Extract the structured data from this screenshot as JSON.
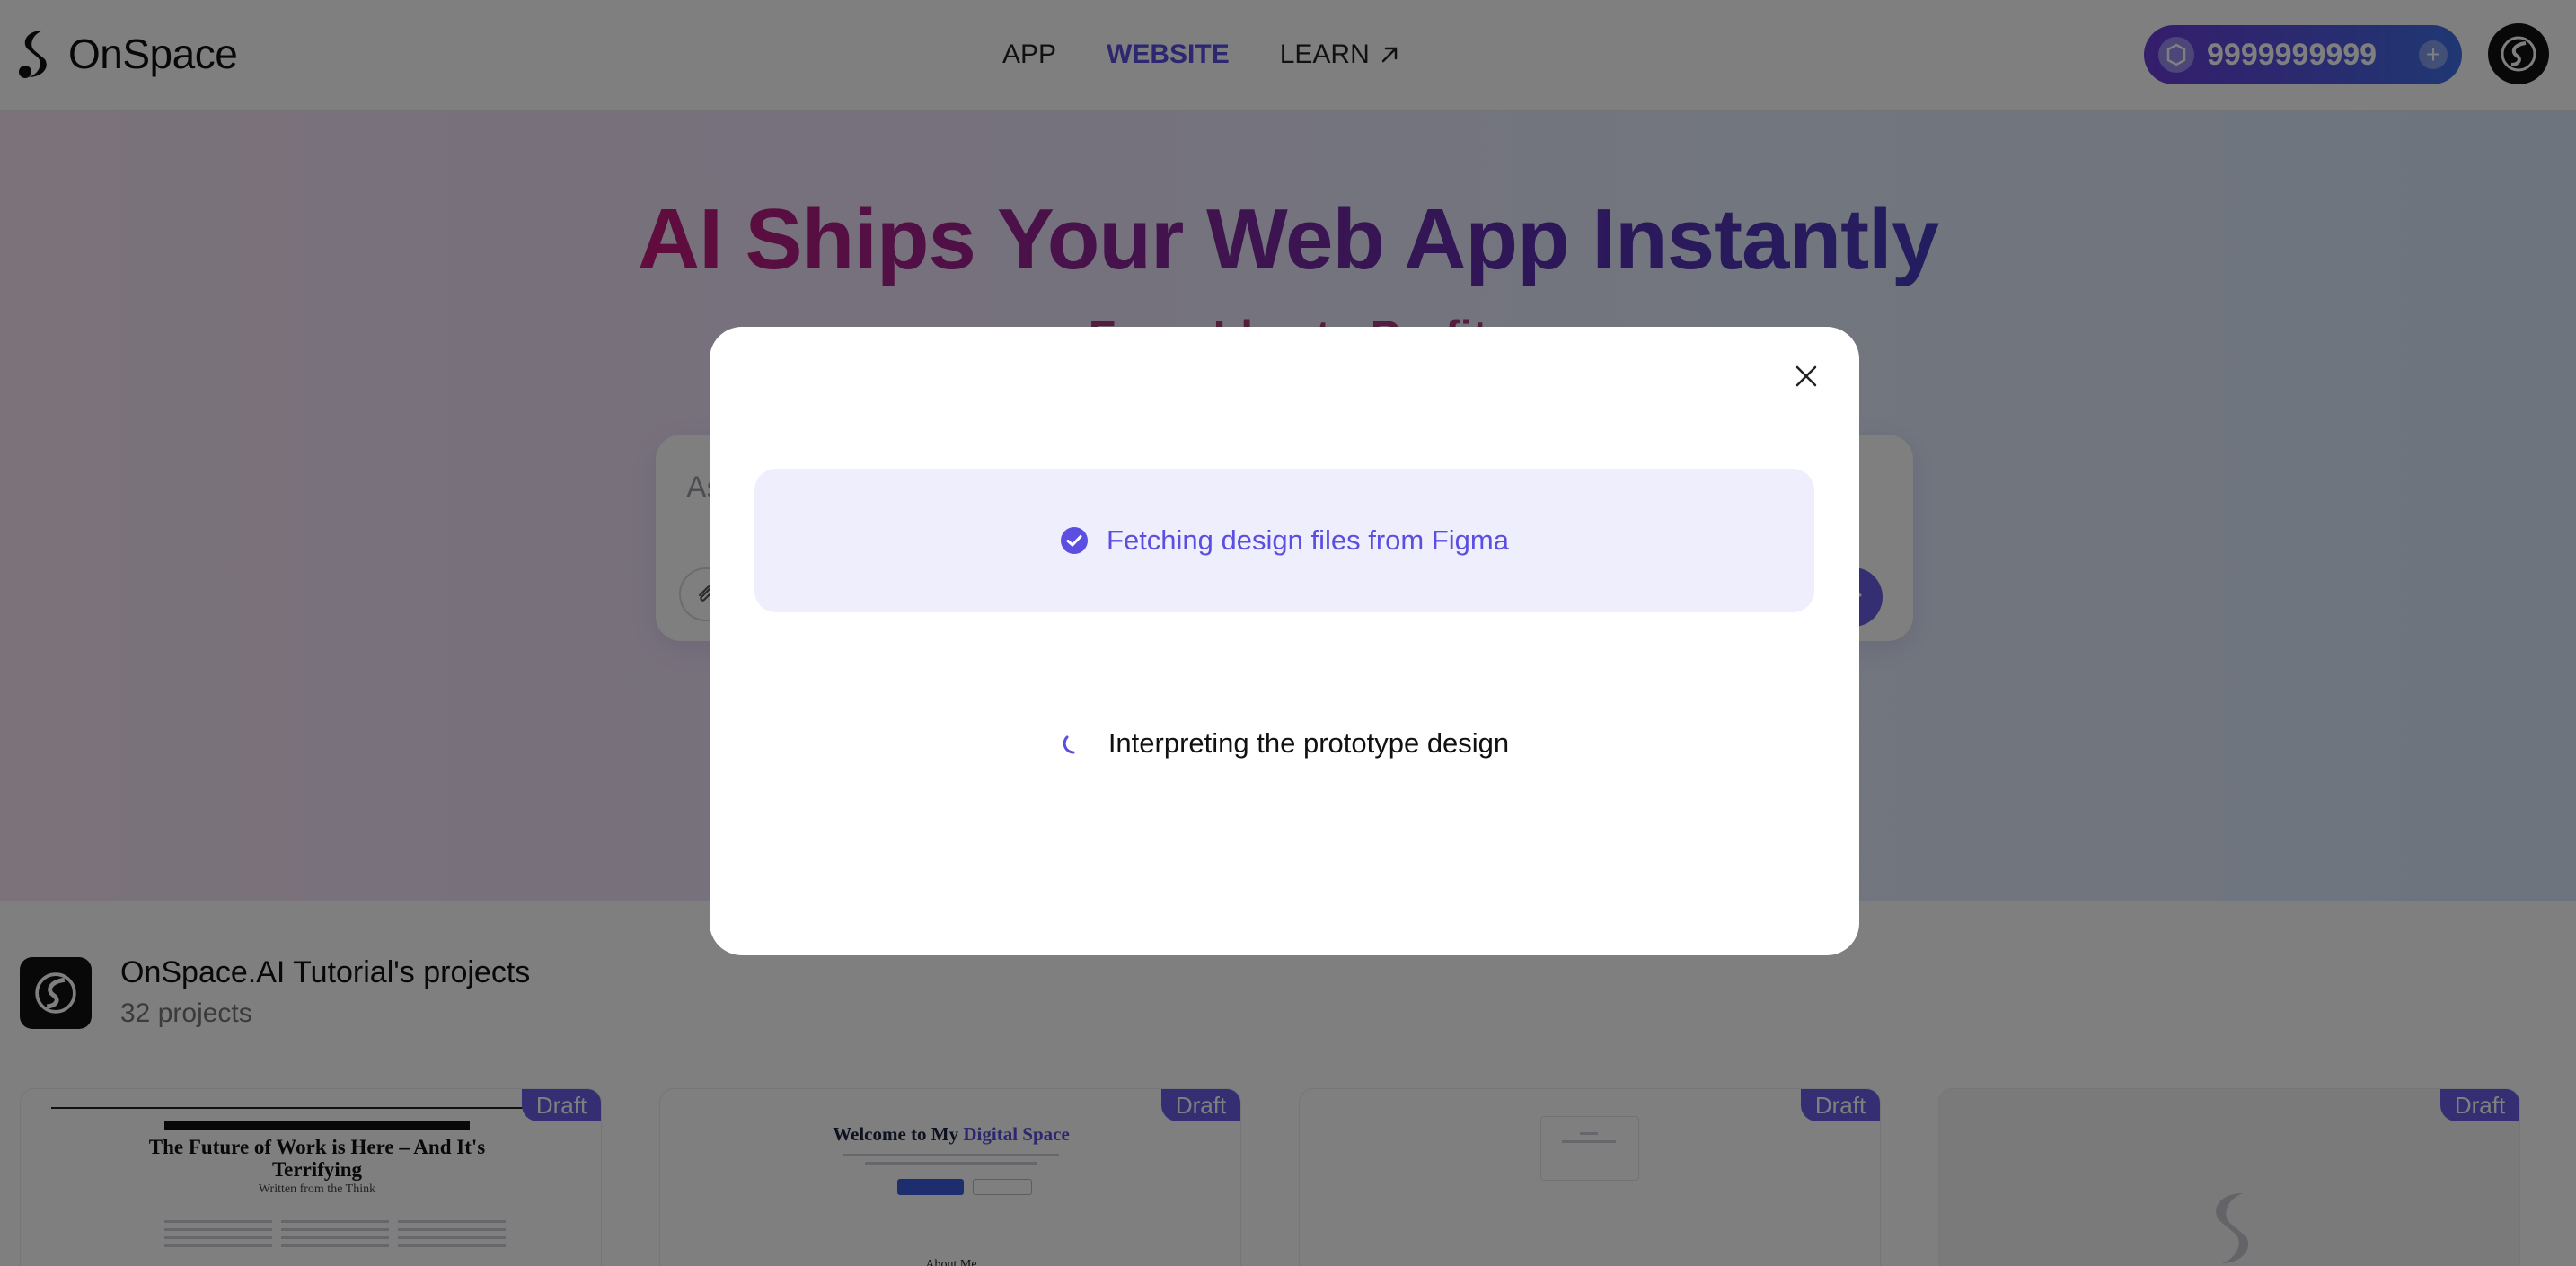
{
  "brand": {
    "name": "OnSpace"
  },
  "nav": {
    "items": [
      {
        "label": "APP"
      },
      {
        "label": "WEBSITE"
      },
      {
        "label": "LEARN"
      }
    ]
  },
  "credits": {
    "value": "9999999999"
  },
  "hero": {
    "title": "AI Ships Your Web App Instantly",
    "subtitle": "From Idea to Profit",
    "prompt_placeholder": "As"
  },
  "projects": {
    "title": "OnSpace.AI Tutorial's projects",
    "count": "32 projects",
    "draft_label": "Draft",
    "cards": [
      {
        "headline": "The Future of Work is Here – And It's Terrifying",
        "byline": "Written from the Think"
      },
      {
        "headline_prefix": "Welcome to My ",
        "headline_accent": "Digital Space",
        "section": "About Me"
      }
    ]
  },
  "modal": {
    "steps": [
      {
        "label": "Fetching design files from Figma",
        "status": "done"
      },
      {
        "label": "Interpreting the prototype design",
        "status": "in-progress"
      }
    ]
  },
  "colors": {
    "accent": "#5b4ee0",
    "step_done_bg": "#efeefd",
    "overlay": "rgba(0,0,0,0.5)"
  }
}
